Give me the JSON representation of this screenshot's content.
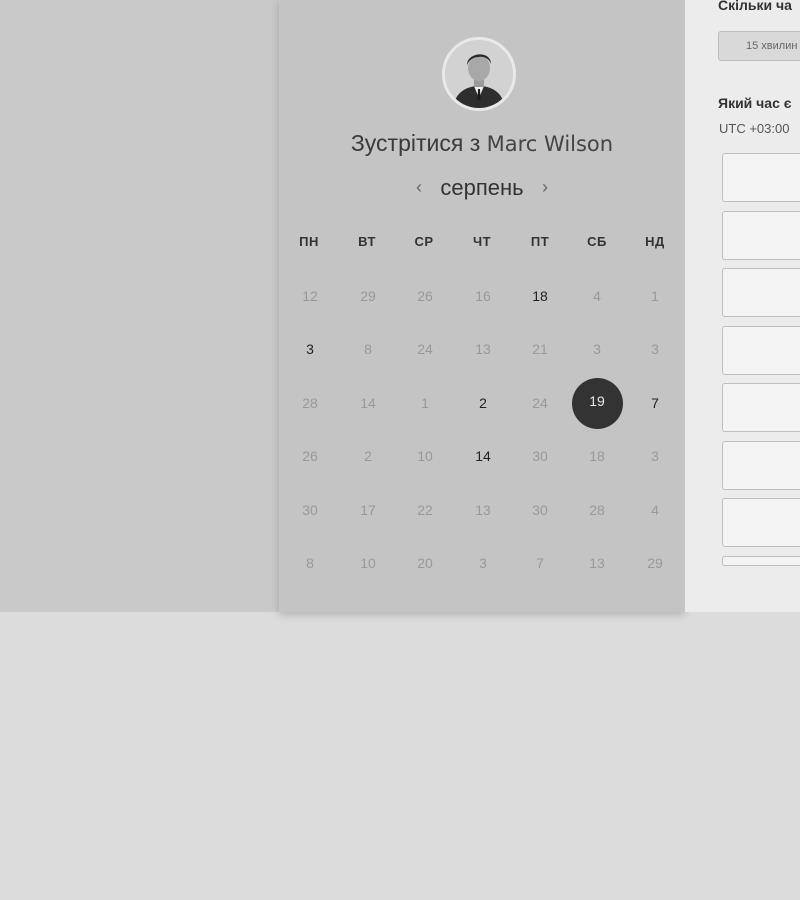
{
  "booking": {
    "title_prefix": "Зустрітися з",
    "host_name": "Marc Wilson",
    "avatar_icon": "person-photo",
    "calendar": {
      "month": "серпень",
      "prev_icon": "chevron-left-icon",
      "next_icon": "chevron-right-icon",
      "weekdays": [
        "ПН",
        "ВТ",
        "СР",
        "ЧТ",
        "ПТ",
        "СБ",
        "НД"
      ],
      "weeks": [
        [
          {
            "d": "12",
            "s": "disabled"
          },
          {
            "d": "29",
            "s": "disabled"
          },
          {
            "d": "26",
            "s": "disabled"
          },
          {
            "d": "16",
            "s": "disabled"
          },
          {
            "d": "18",
            "s": "available"
          },
          {
            "d": "4",
            "s": "disabled"
          },
          {
            "d": "1",
            "s": "disabled"
          }
        ],
        [
          {
            "d": "3",
            "s": "available"
          },
          {
            "d": "8",
            "s": "disabled"
          },
          {
            "d": "24",
            "s": "disabled"
          },
          {
            "d": "13",
            "s": "disabled"
          },
          {
            "d": "21",
            "s": "disabled"
          },
          {
            "d": "3",
            "s": "disabled"
          },
          {
            "d": "3",
            "s": "disabled"
          }
        ],
        [
          {
            "d": "28",
            "s": "disabled"
          },
          {
            "d": "14",
            "s": "disabled"
          },
          {
            "d": "1",
            "s": "disabled"
          },
          {
            "d": "2",
            "s": "available"
          },
          {
            "d": "24",
            "s": "disabled"
          },
          {
            "d": "19",
            "s": "selected"
          },
          {
            "d": "7",
            "s": "available"
          }
        ],
        [
          {
            "d": "26",
            "s": "disabled"
          },
          {
            "d": "2",
            "s": "disabled"
          },
          {
            "d": "10",
            "s": "disabled"
          },
          {
            "d": "14",
            "s": "available"
          },
          {
            "d": "30",
            "s": "disabled"
          },
          {
            "d": "18",
            "s": "disabled"
          },
          {
            "d": "3",
            "s": "disabled"
          }
        ],
        [
          {
            "d": "30",
            "s": "disabled"
          },
          {
            "d": "17",
            "s": "disabled"
          },
          {
            "d": "22",
            "s": "disabled"
          },
          {
            "d": "13",
            "s": "disabled"
          },
          {
            "d": "30",
            "s": "disabled"
          },
          {
            "d": "28",
            "s": "disabled"
          },
          {
            "d": "4",
            "s": "disabled"
          }
        ],
        [
          {
            "d": "8",
            "s": "disabled"
          },
          {
            "d": "10",
            "s": "disabled"
          },
          {
            "d": "20",
            "s": "disabled"
          },
          {
            "d": "3",
            "s": "disabled"
          },
          {
            "d": "7",
            "s": "disabled"
          },
          {
            "d": "13",
            "s": "disabled"
          },
          {
            "d": "29",
            "s": "disabled"
          }
        ]
      ]
    }
  },
  "scheduler": {
    "duration_question": "Скільки ча",
    "duration_option": "15 хвилин",
    "time_question": "Який час є",
    "timezone": "UTC +03:00",
    "slots": [
      "",
      "",
      "",
      "",
      "",
      "",
      "",
      ""
    ]
  },
  "colors": {
    "selected_day": "#333333",
    "available_day": "#222222",
    "disabled_day": "#999999"
  }
}
